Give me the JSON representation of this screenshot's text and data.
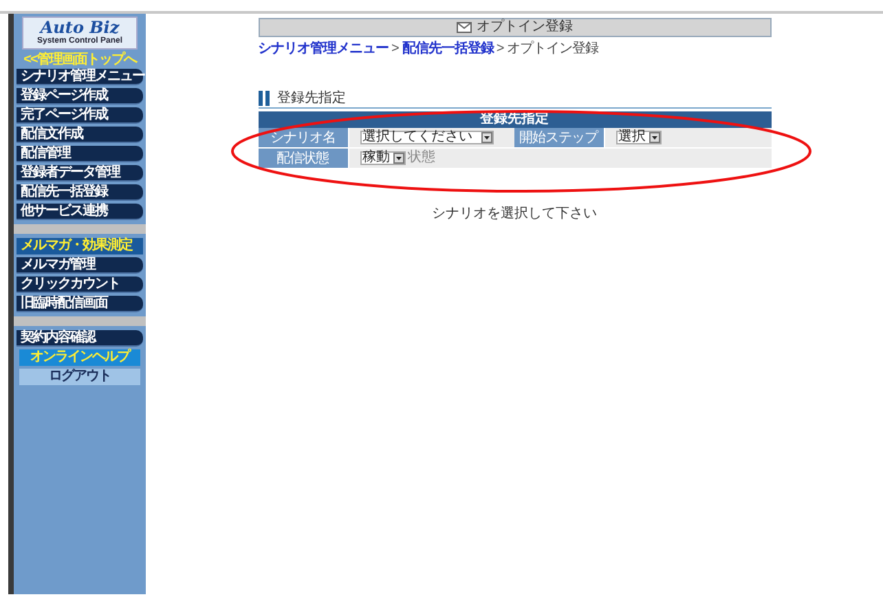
{
  "sidebar": {
    "logo": {
      "title": "Auto Biz",
      "subtitle": "System Control Panel"
    },
    "top_link": "<<管理画面トップへ",
    "items": [
      {
        "kind": "nav",
        "label": "シナリオ管理メニュー"
      },
      {
        "kind": "nav",
        "label": "登録ページ作成"
      },
      {
        "kind": "nav",
        "label": "完了ページ作成"
      },
      {
        "kind": "nav",
        "label": "配信文作成"
      },
      {
        "kind": "nav",
        "label": "配信管理"
      },
      {
        "kind": "nav",
        "label": "登録者データ管理"
      },
      {
        "kind": "nav",
        "label": "配信先一括登録"
      },
      {
        "kind": "nav",
        "label": "他サービス連携"
      },
      {
        "kind": "divider"
      },
      {
        "kind": "section",
        "label": "メルマガ・効果測定"
      },
      {
        "kind": "nav",
        "label": "メルマガ管理"
      },
      {
        "kind": "nav",
        "label": "クリックカウント"
      },
      {
        "kind": "nav",
        "label": "旧臨時配信画面"
      },
      {
        "kind": "divider"
      },
      {
        "kind": "nav",
        "label": "契約内容確認"
      },
      {
        "kind": "help",
        "label": "オンラインヘルプ"
      },
      {
        "kind": "logout",
        "label": "ログアウト"
      }
    ]
  },
  "header": {
    "title": "オプトイン登録"
  },
  "breadcrumb": {
    "separator": ">",
    "items": [
      {
        "label": "シナリオ管理メニュー",
        "link": true
      },
      {
        "label": "配信先一括登録",
        "link": true
      },
      {
        "label": "オプトイン登録",
        "link": false
      }
    ]
  },
  "section_title": "登録先指定",
  "form": {
    "title": "登録先指定",
    "rows": [
      [
        {
          "label": "シナリオ名",
          "value": "選択してください",
          "wide": true
        },
        {
          "label": "開始ステップ",
          "value": "選択",
          "wide": false
        }
      ],
      [
        {
          "label": "配信状態",
          "value": "稼動",
          "wide": false,
          "suffix": "状態"
        }
      ]
    ]
  },
  "message": "シナリオを選択して下さい"
}
